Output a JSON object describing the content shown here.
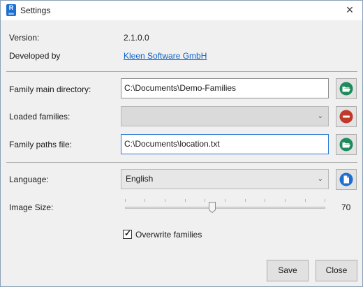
{
  "window": {
    "title": "Settings",
    "app_icon_letter": "R",
    "app_icon_sub": "BIM"
  },
  "about": {
    "version_label": "Version:",
    "version_value": "2.1.0.0",
    "developer_label": "Developed by",
    "developer_value": "Kleen Software GmbH"
  },
  "families": {
    "main_dir_label": "Family main directory:",
    "main_dir_value": "C:\\Documents\\Demo-Families",
    "loaded_label": "Loaded families:",
    "loaded_value": "",
    "paths_file_label": "Family paths file:",
    "paths_file_value": "C:\\Documents\\location.txt"
  },
  "options": {
    "language_label": "Language:",
    "language_value": "English",
    "image_size_label": "Image Size:",
    "image_size_value": "70",
    "overwrite_label": "Overwrite families",
    "overwrite_checked": true
  },
  "buttons": {
    "save": "Save",
    "close": "Close"
  },
  "colors": {
    "accent": "#0b63c8",
    "folder_green": "#1e8a5e",
    "remove_red": "#c0392b",
    "doc_blue": "#1f6fd1"
  },
  "icons": [
    "close-icon",
    "folder-open-icon",
    "remove-icon",
    "document-icon",
    "chevron-down-icon",
    "check-icon"
  ]
}
